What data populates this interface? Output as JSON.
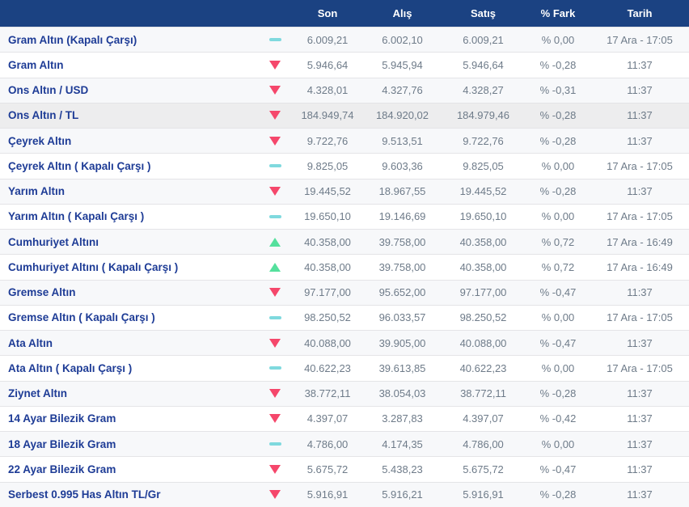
{
  "colors": {
    "header_bg": "#1b4282",
    "name_text": "#1e3c96",
    "value_text": "#6e7b89",
    "up_arrow": "#55e09d",
    "down_arrow": "#f5476b",
    "flat_dash": "#7fd9de",
    "row_alt_bg": "#f7f8fa",
    "row_highlight_bg": "#ededee",
    "row_border": "#e4e4e7"
  },
  "table": {
    "columns": {
      "name": "",
      "trend": "",
      "son": "Son",
      "alis": "Alış",
      "satis": "Satış",
      "fark": "% Fark",
      "tarih": "Tarih"
    },
    "rows": [
      {
        "name": "Gram Altın (Kapalı Çarşı)",
        "trend": "flat",
        "son": "6.009,21",
        "alis": "6.002,10",
        "satis": "6.009,21",
        "fark": "% 0,00",
        "tarih": "17 Ara - 17:05",
        "highlighted": false
      },
      {
        "name": "Gram Altın",
        "trend": "down",
        "son": "5.946,64",
        "alis": "5.945,94",
        "satis": "5.946,64",
        "fark": "% -0,28",
        "tarih": "11:37",
        "highlighted": false
      },
      {
        "name": "Ons Altın / USD",
        "trend": "down",
        "son": "4.328,01",
        "alis": "4.327,76",
        "satis": "4.328,27",
        "fark": "% -0,31",
        "tarih": "11:37",
        "highlighted": false
      },
      {
        "name": "Ons Altın / TL",
        "trend": "down",
        "son": "184.949,74",
        "alis": "184.920,02",
        "satis": "184.979,46",
        "fark": "% -0,28",
        "tarih": "11:37",
        "highlighted": true
      },
      {
        "name": "Çeyrek Altın",
        "trend": "down",
        "son": "9.722,76",
        "alis": "9.513,51",
        "satis": "9.722,76",
        "fark": "% -0,28",
        "tarih": "11:37",
        "highlighted": false
      },
      {
        "name": "Çeyrek Altın ( Kapalı Çarşı )",
        "trend": "flat",
        "son": "9.825,05",
        "alis": "9.603,36",
        "satis": "9.825,05",
        "fark": "% 0,00",
        "tarih": "17 Ara - 17:05",
        "highlighted": false
      },
      {
        "name": "Yarım Altın",
        "trend": "down",
        "son": "19.445,52",
        "alis": "18.967,55",
        "satis": "19.445,52",
        "fark": "% -0,28",
        "tarih": "11:37",
        "highlighted": false
      },
      {
        "name": "Yarım Altın ( Kapalı Çarşı )",
        "trend": "flat",
        "son": "19.650,10",
        "alis": "19.146,69",
        "satis": "19.650,10",
        "fark": "% 0,00",
        "tarih": "17 Ara - 17:05",
        "highlighted": false
      },
      {
        "name": "Cumhuriyet Altını",
        "trend": "up",
        "son": "40.358,00",
        "alis": "39.758,00",
        "satis": "40.358,00",
        "fark": "% 0,72",
        "tarih": "17 Ara - 16:49",
        "highlighted": false
      },
      {
        "name": "Cumhuriyet Altını ( Kapalı Çarşı )",
        "trend": "up",
        "son": "40.358,00",
        "alis": "39.758,00",
        "satis": "40.358,00",
        "fark": "% 0,72",
        "tarih": "17 Ara - 16:49",
        "highlighted": false
      },
      {
        "name": "Gremse Altın",
        "trend": "down",
        "son": "97.177,00",
        "alis": "95.652,00",
        "satis": "97.177,00",
        "fark": "% -0,47",
        "tarih": "11:37",
        "highlighted": false
      },
      {
        "name": "Gremse Altın ( Kapalı Çarşı )",
        "trend": "flat",
        "son": "98.250,52",
        "alis": "96.033,57",
        "satis": "98.250,52",
        "fark": "% 0,00",
        "tarih": "17 Ara - 17:05",
        "highlighted": false
      },
      {
        "name": "Ata Altın",
        "trend": "down",
        "son": "40.088,00",
        "alis": "39.905,00",
        "satis": "40.088,00",
        "fark": "% -0,47",
        "tarih": "11:37",
        "highlighted": false
      },
      {
        "name": "Ata Altın ( Kapalı Çarşı )",
        "trend": "flat",
        "son": "40.622,23",
        "alis": "39.613,85",
        "satis": "40.622,23",
        "fark": "% 0,00",
        "tarih": "17 Ara - 17:05",
        "highlighted": false
      },
      {
        "name": "Ziynet Altın",
        "trend": "down",
        "son": "38.772,11",
        "alis": "38.054,03",
        "satis": "38.772,11",
        "fark": "% -0,28",
        "tarih": "11:37",
        "highlighted": false
      },
      {
        "name": "14 Ayar Bilezik Gram",
        "trend": "down",
        "son": "4.397,07",
        "alis": "3.287,83",
        "satis": "4.397,07",
        "fark": "% -0,42",
        "tarih": "11:37",
        "highlighted": false
      },
      {
        "name": "18 Ayar Bilezik Gram",
        "trend": "flat",
        "son": "4.786,00",
        "alis": "4.174,35",
        "satis": "4.786,00",
        "fark": "% 0,00",
        "tarih": "11:37",
        "highlighted": false
      },
      {
        "name": "22 Ayar Bilezik Gram",
        "trend": "down",
        "son": "5.675,72",
        "alis": "5.438,23",
        "satis": "5.675,72",
        "fark": "% -0,47",
        "tarih": "11:37",
        "highlighted": false
      },
      {
        "name": "Serbest 0.995 Has Altın TL/Gr",
        "trend": "down",
        "son": "5.916,91",
        "alis": "5.916,21",
        "satis": "5.916,91",
        "fark": "% -0,28",
        "tarih": "11:37",
        "highlighted": false
      }
    ]
  }
}
